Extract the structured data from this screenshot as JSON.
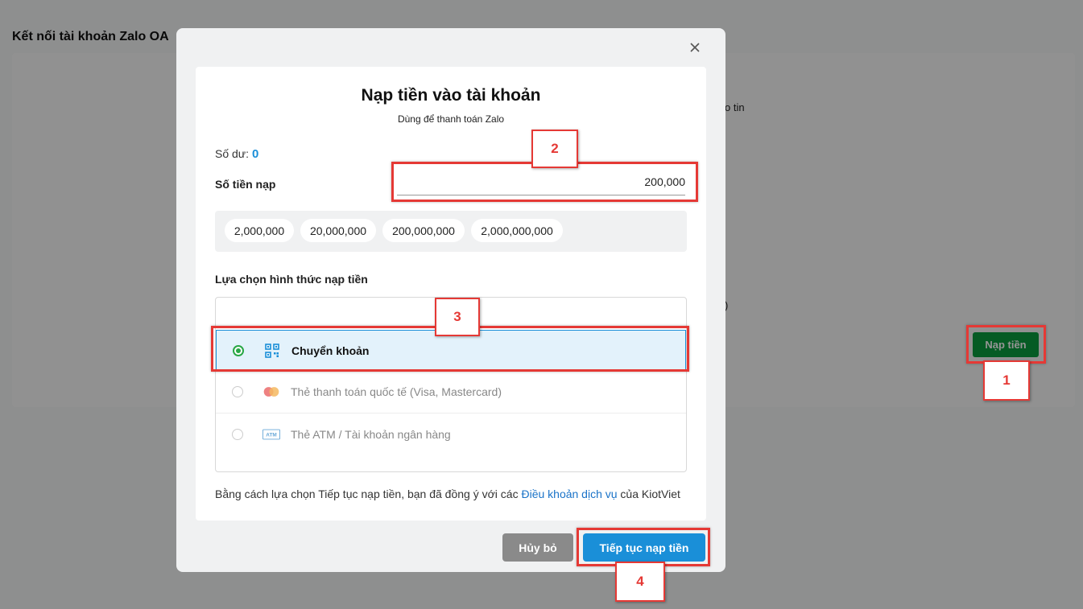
{
  "page": {
    "title": "Kết nối tài khoản Zalo OA",
    "fragment_1": "o tin",
    "fragment_2": ")",
    "topup_button": "Nạp tiền"
  },
  "modal": {
    "title": "Nạp tiền vào tài khoản",
    "subtitle": "Dùng để thanh toán Zalo",
    "balance_label": "Số dư:",
    "balance_value": "0",
    "amount_label": "Số tiền nạp",
    "amount_value": "200,000",
    "presets": [
      "2,000,000",
      "20,000,000",
      "200,000,000",
      "2,000,000,000"
    ],
    "method_section_label": "Lựa chọn hình thức nạp tiền",
    "methods": [
      {
        "label": "Chuyển khoản",
        "icon": "qr-code-icon",
        "selected": true
      },
      {
        "label": "Thẻ thanh toán quốc tế (Visa, Mastercard)",
        "icon": "mastercard-icon",
        "selected": false
      },
      {
        "label": "Thẻ ATM / Tài khoản ngân hàng",
        "icon": "atm-card-icon",
        "selected": false
      }
    ],
    "atm_icon_text": "ATM",
    "terms_prefix": "Bằng cách lựa chọn Tiếp tục nạp tiền, bạn đã đồng ý với các ",
    "terms_link": "Điều khoản dịch vụ",
    "terms_suffix": " của KiotViet",
    "cancel_label": "Hủy bỏ",
    "continue_label": "Tiếp tục nạp tiền"
  },
  "annotations": {
    "step_1": "1",
    "step_2": "2",
    "step_3": "3",
    "step_4": "4"
  },
  "colors": {
    "accent": "#1a8fd8",
    "topup_green": "#0a9e3f",
    "annotation_red": "#e53935",
    "selected_radio": "#28a745"
  }
}
